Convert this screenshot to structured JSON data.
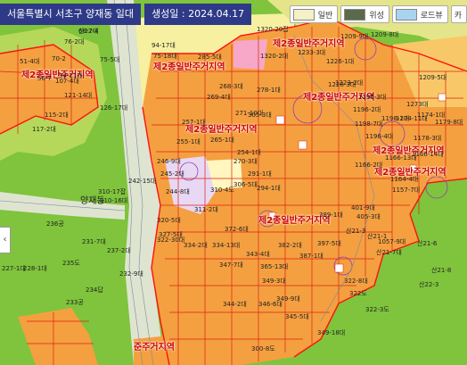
{
  "header": {
    "location": "서울특별시 서초구 양재동 일대",
    "date": "생성일 : 2024.04.17"
  },
  "controls": [
    {
      "name": "map-type-general",
      "label": "일반",
      "color": "#f4f0c8"
    },
    {
      "name": "map-type-satellite",
      "label": "위성",
      "color": "#5a6a4a"
    },
    {
      "name": "map-type-roadview",
      "label": "로드뷰",
      "color": "#a8d4f0"
    },
    {
      "name": "map-type-cadastral",
      "label": "카",
      "color": "#f4f0c8"
    }
  ],
  "side_button": "‹",
  "places": {
    "district": "양재동"
  },
  "zones": {
    "z1": "제2종일반주거지역",
    "z2": "제2종일반주거지역",
    "z3": "제2종일반주거지역",
    "z4": "제2종일반주거지역",
    "z5": "제2종일반주거지역",
    "z6": "제2종일반주거지역",
    "z7": "제2종일반주거지역",
    "z8": "제2종일반주거지역",
    "z9": "준주거지역"
  },
  "parcels": [
    "68-7대",
    "76-2대",
    "70-2",
    "75-5대",
    "94-17대",
    "75-18대",
    "51-4대",
    "94-11대",
    "56-7",
    "107-4대",
    "121-14대",
    "126-17대",
    "115-2대",
    "117-2대",
    "285-5대",
    "1320-20잡",
    "1320-2대",
    "1209-9대",
    "1209-8대",
    "1233-3대",
    "1226-1대",
    "1223-2대",
    "1273대",
    "1228-3대",
    "1196-2대",
    "1209-5대",
    "1198-7대",
    "1196-3대",
    "1179-8대",
    "1178-3대",
    "1174-11대",
    "1174-1대",
    "1198-2대",
    "1196-4대",
    "1166-13대",
    "1166-14대",
    "1166-2대",
    "1164-4대",
    "1157-7대",
    "1057-9대",
    "268-3대",
    "269-4대",
    "278-1대",
    "271-10대",
    "257-1대",
    "255-1대",
    "254-1대",
    "265-1대",
    "305-3대",
    "270-3대",
    "291-1대",
    "294-1대",
    "246-9대",
    "245-2대",
    "242-15대",
    "244-8대",
    "310-4도",
    "306-5대",
    "311-2대",
    "320-5대",
    "327-5대",
    "322-30대",
    "334-2대",
    "310-17잡",
    "310-16대",
    "236공",
    "237-2대",
    "231-7대",
    "228-1대",
    "227-1대",
    "235도",
    "234답",
    "233공",
    "232-9대",
    "372-6대",
    "334-13대",
    "343-4대",
    "365-13대",
    "347-7대",
    "349-3대",
    "382-2대",
    "387-1대",
    "397-5대",
    "389-1대",
    "401-9대",
    "405-3대",
    "349-9대",
    "345-5대",
    "346-6대",
    "344-2대",
    "300-8도",
    "349-18대",
    "322-8대",
    "322도",
    "322-3도",
    "산21-1",
    "산21-7대",
    "산21-6",
    "산21-3",
    "산21-8",
    "산22-3",
    "산22-4"
  ]
}
